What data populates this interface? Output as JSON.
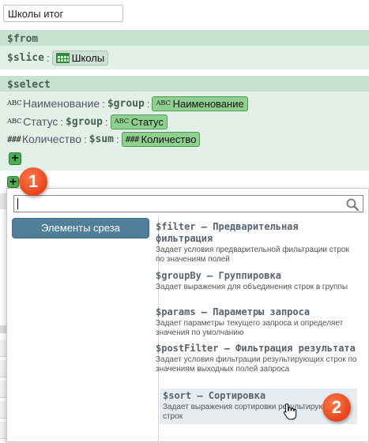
{
  "query_name": "Школы итог",
  "from_section": {
    "header": "$from",
    "slice_keyword": "$slice",
    "slice_value": "Школы"
  },
  "select_section": {
    "header": "$select",
    "fields": [
      {
        "type_icon": "ABC",
        "name": "Наименование",
        "op": "$group",
        "chip_type": "ABC",
        "chip_value": "Наименование"
      },
      {
        "type_icon": "ABC",
        "name": "Статус",
        "op": "$group",
        "chip_type": "ABC",
        "chip_value": "Статус"
      },
      {
        "type_icon": "###",
        "name": "Количество",
        "op": "$sum",
        "chip_type": "###",
        "chip_value": "Количество"
      }
    ],
    "add_symbol": "+"
  },
  "add_clause_symbol": "+",
  "popup": {
    "search_value": "",
    "category": "Элементы среза",
    "items": [
      {
        "title": "$filter – Предварительная фильтрация",
        "description": "Задает условия предварительной фильтрации строк по значениям полей"
      },
      {
        "title": "$groupBy – Группировка",
        "description": "Задает выражения для объединения строк в группы"
      },
      {
        "title": "$params – Параметры запроса",
        "description": "Задает параметры текущего запроса и определяет значения по умолчанию"
      },
      {
        "title": "$postFilter – Фильтрация результата",
        "description": "Задает условия фильтрации результирующих строк по значениям выходных полей запроса"
      },
      {
        "title": "$sort – Сортировка",
        "description": "Задает выражения сортировки результирующих строк"
      }
    ]
  },
  "badges": {
    "first": "1",
    "second": "2"
  },
  "colors": {
    "section_header": "#c7e2d1",
    "section_body": "#e3f0e7",
    "chip": "#8fd08e",
    "category_button": "#4f7f99",
    "badge": "#e8431a"
  },
  "icons": [
    "table-icon",
    "search-icon",
    "hand-cursor-icon",
    "plus-icon"
  ]
}
